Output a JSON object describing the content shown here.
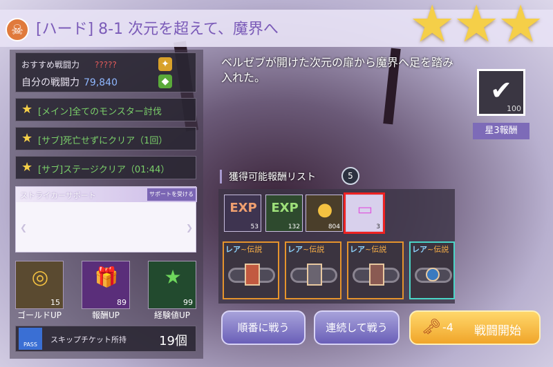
{
  "header": {
    "title": "[ハード] 8-1 次元を超えて、魔界へ",
    "skull_icon": "skull-icon",
    "stars_earned": 3
  },
  "power": {
    "recommended_label": "おすすめ戦闘力",
    "recommended_value": "?????",
    "own_label": "自分の戦闘力",
    "own_value": "79,840"
  },
  "missions": [
    {
      "text": "[メイン]全てのモンスター討伐"
    },
    {
      "text": "[サブ]死亡せずにクリア（1回）"
    },
    {
      "text": "[サブ]ステージクリア（01:44）"
    }
  ],
  "support": {
    "title": "ストライカーサポート",
    "button": "サポートを受ける"
  },
  "boosts": [
    {
      "count": "15",
      "label": "ゴールドUP"
    },
    {
      "count": "89",
      "label": "報酬UP"
    },
    {
      "count": "99",
      "label": "経験値UP"
    }
  ],
  "skip": {
    "icon_label": "PASS",
    "label": "スキップチケット所持",
    "value": "19個"
  },
  "description": "ベルゼブが開けた次元の扉から魔界へ足を踏み入れた。",
  "star3_reward": {
    "count": "100",
    "label": "星3報酬"
  },
  "reward_list": {
    "title": "獲得可能報酬リスト",
    "count": "5",
    "items": [
      {
        "glyph": "EXP",
        "count": "53"
      },
      {
        "glyph": "EXP",
        "count": "132"
      },
      {
        "glyph": "●",
        "count": "804"
      },
      {
        "glyph": "▭",
        "count": "3"
      }
    ],
    "gear": [
      {
        "rarity_a": "レア",
        "rarity_b": "~伝説"
      },
      {
        "rarity_a": "レア",
        "rarity_b": "~伝説"
      },
      {
        "rarity_a": "レア",
        "rarity_b": "~伝説"
      },
      {
        "rarity_a": "レア",
        "rarity_b": "~伝説"
      }
    ]
  },
  "buttons": {
    "sequential": "順番に戦う",
    "continuous": "連続して戦う",
    "start_cost": "-4",
    "start": "戦闘開始"
  }
}
